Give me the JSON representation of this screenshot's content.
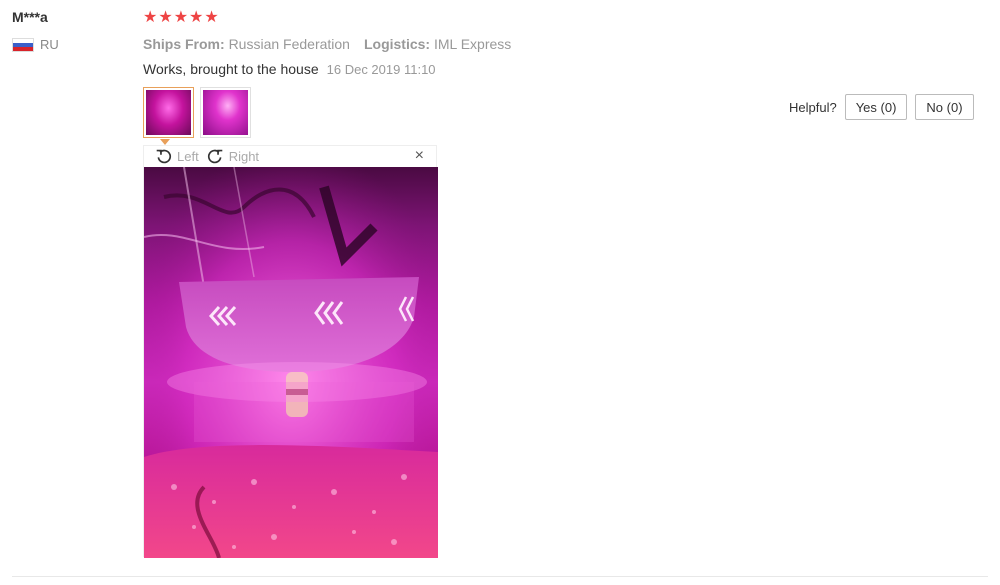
{
  "reviewer": {
    "name": "M***a",
    "country": "RU"
  },
  "rating": {
    "stars": 5
  },
  "meta": {
    "ships_from_label": "Ships From:",
    "ships_from_value": "Russian Federation",
    "logistics_label": "Logistics:",
    "logistics_value": "IML Express"
  },
  "review": {
    "text": "Works, brought to the house",
    "date": "16 Dec 2019 11:10"
  },
  "helpful": {
    "label": "Helpful?",
    "yes_label": "Yes (0)",
    "no_label": "No (0)"
  },
  "viewer": {
    "rotate_left_label": "Left",
    "rotate_right_label": "Right",
    "close_label": "×"
  },
  "icons": {
    "close": "close-icon",
    "rotate_left": "rotate-left-icon",
    "rotate_right": "rotate-right-icon",
    "star": "star-icon",
    "flag": "russia-flag-icon"
  },
  "colors": {
    "star": "#ee4444",
    "thumb_active_border": "#e8a05a"
  }
}
